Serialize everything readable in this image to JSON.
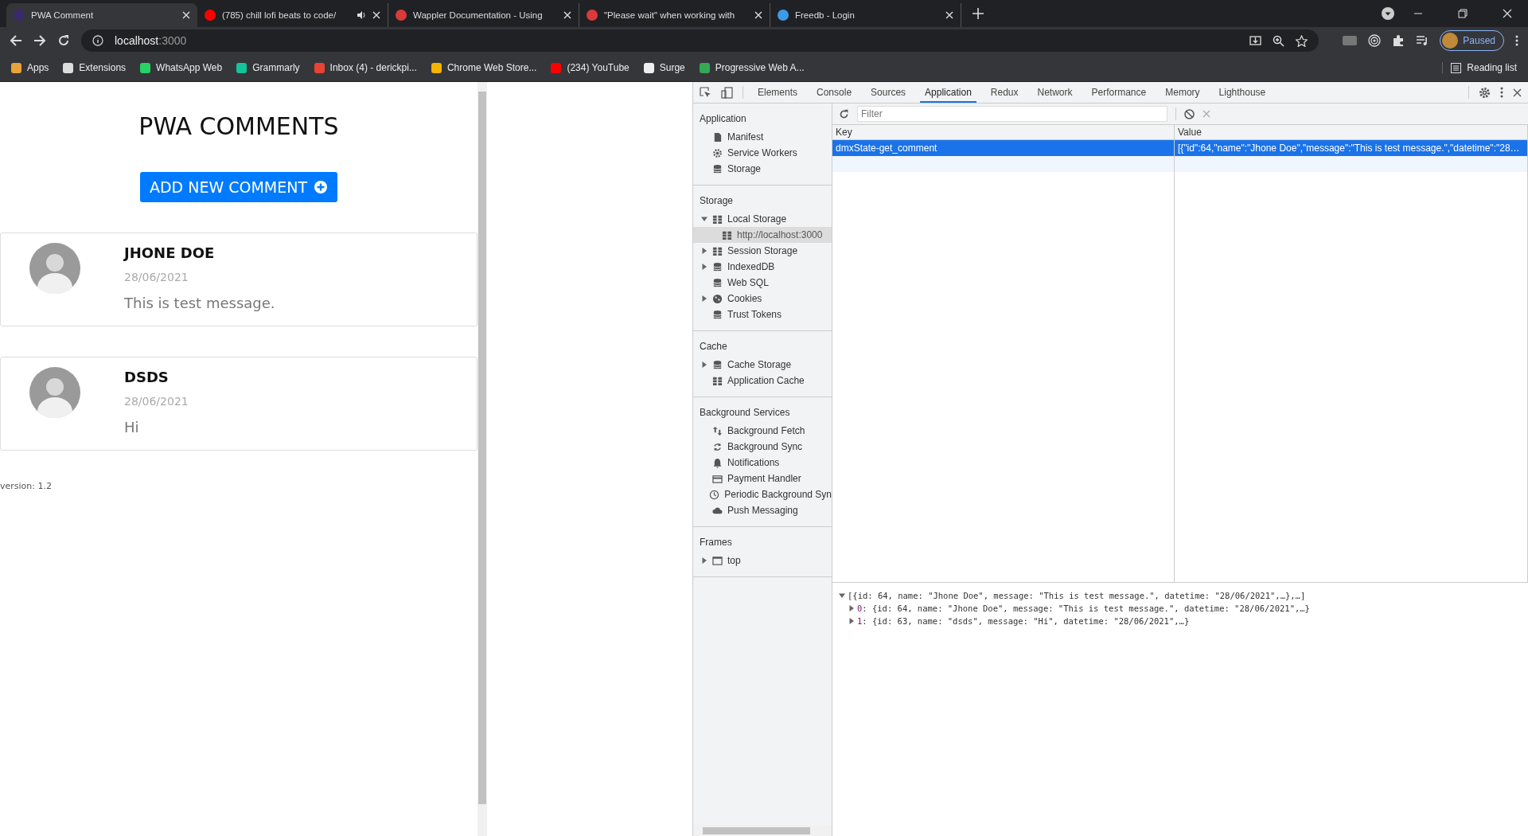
{
  "browser": {
    "tabs": [
      {
        "title": "PWA Comment",
        "kind": "app",
        "selected": true,
        "audio": false
      },
      {
        "title": "(785) chill lofi beats to code/",
        "kind": "video",
        "selected": false,
        "audio": true
      },
      {
        "title": "Wappler Documentation - Using",
        "kind": "wappler",
        "selected": false,
        "audio": false
      },
      {
        "title": "\"Please wait\" when working with",
        "kind": "wappler",
        "selected": false,
        "audio": false
      },
      {
        "title": "Freedb - Login",
        "kind": "database",
        "selected": false,
        "audio": false
      }
    ],
    "address": {
      "host": "localhost",
      "port": ":3000"
    },
    "profile": {
      "label": "Paused"
    },
    "bookmarks": [
      {
        "label": "Apps",
        "kind": "apps"
      },
      {
        "label": "Extensions",
        "kind": "puzzle"
      },
      {
        "label": "WhatsApp Web",
        "kind": "chat"
      },
      {
        "label": "Grammarly",
        "kind": "grammar"
      },
      {
        "label": "Inbox (4) - derickpi...",
        "kind": "mail"
      },
      {
        "label": "Chrome Web Store...",
        "kind": "store"
      },
      {
        "label": "(234) YouTube",
        "kind": "video"
      },
      {
        "label": "Surge",
        "kind": "globe"
      },
      {
        "label": "Progressive Web A...",
        "kind": "drive"
      }
    ],
    "reading_list": "Reading list"
  },
  "page": {
    "title": "PWA COMMENTS",
    "add_button": "ADD NEW COMMENT",
    "comments": [
      {
        "name": "JHONE DOE",
        "date": "28/06/2021",
        "message": "This is test message."
      },
      {
        "name": "DSDS",
        "date": "28/06/2021",
        "message": "Hi"
      }
    ],
    "version": "version: 1.2"
  },
  "devtools": {
    "tabs": [
      {
        "label": "Elements",
        "selected": false
      },
      {
        "label": "Console",
        "selected": false
      },
      {
        "label": "Sources",
        "selected": false
      },
      {
        "label": "Application",
        "selected": true
      },
      {
        "label": "Redux",
        "selected": false
      },
      {
        "label": "Network",
        "selected": false
      },
      {
        "label": "Performance",
        "selected": false
      },
      {
        "label": "Memory",
        "selected": false
      },
      {
        "label": "Lighthouse",
        "selected": false
      }
    ],
    "sidebar": [
      {
        "heading": "Application",
        "items": [
          {
            "label": "Manifest",
            "kind": "file",
            "selected": false
          },
          {
            "label": "Service Workers",
            "kind": "gear",
            "selected": false
          },
          {
            "label": "Storage",
            "kind": "db",
            "selected": false
          }
        ]
      },
      {
        "heading": "Storage",
        "items": [
          {
            "label": "Local Storage",
            "kind": "grid",
            "selected": false,
            "expanded": true,
            "children": [
              {
                "label": "http://localhost:3000",
                "kind": "grid",
                "selected": true
              }
            ]
          },
          {
            "label": "Session Storage",
            "kind": "grid",
            "selected": false,
            "expanded": false
          },
          {
            "label": "IndexedDB",
            "kind": "db",
            "selected": false,
            "expanded": false
          },
          {
            "label": "Web SQL",
            "kind": "db",
            "selected": false
          },
          {
            "label": "Cookies",
            "kind": "cookie",
            "selected": false,
            "expanded": false
          },
          {
            "label": "Trust Tokens",
            "kind": "db",
            "selected": false
          }
        ]
      },
      {
        "heading": "Cache",
        "items": [
          {
            "label": "Cache Storage",
            "kind": "db",
            "selected": false,
            "expanded": false
          },
          {
            "label": "Application Cache",
            "kind": "grid",
            "selected": false
          }
        ]
      },
      {
        "heading": "Background Services",
        "items": [
          {
            "label": "Background Fetch",
            "kind": "updown",
            "selected": false
          },
          {
            "label": "Background Sync",
            "kind": "sync",
            "selected": false
          },
          {
            "label": "Notifications",
            "kind": "bell",
            "selected": false
          },
          {
            "label": "Payment Handler",
            "kind": "card",
            "selected": false
          },
          {
            "label": "Periodic Background Syn",
            "kind": "clock",
            "selected": false
          },
          {
            "label": "Push Messaging",
            "kind": "cloud",
            "selected": false
          }
        ]
      },
      {
        "heading": "Frames",
        "items": [
          {
            "label": "top",
            "kind": "frame",
            "selected": false,
            "expanded": false
          }
        ]
      }
    ],
    "filter": {
      "placeholder": "Filter"
    },
    "table": {
      "columns": [
        "Key",
        "Value"
      ],
      "rows": [
        {
          "key": "dmxState-get_comment",
          "value": "[{\"id\":64,\"name\":\"Jhone Doe\",\"message\":\"This is test message.\",\"datetime\":\"28…",
          "selected": true
        }
      ]
    },
    "preview": {
      "text": "[{id: 64, name: \"Jhone Doe\", message: \"This is test message.\", datetime: \"28/06/2021\",…},…]",
      "expanded": true,
      "children": [
        {
          "index": "0",
          "text": ": {id: 64, name: \"Jhone Doe\", message: \"This is test message.\", datetime: \"28/06/2021\",…}",
          "expanded": false
        },
        {
          "index": "1",
          "text": ": {id: 63, name: \"dsds\", message: \"Hi\", datetime: \"28/06/2021\",…}",
          "expanded": false
        }
      ]
    }
  }
}
